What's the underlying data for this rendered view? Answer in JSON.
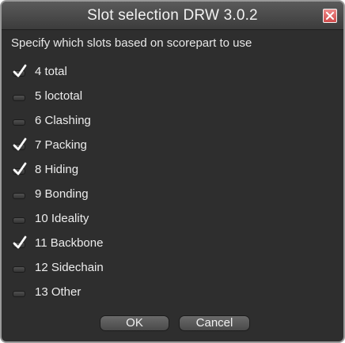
{
  "window": {
    "title": "Slot selection DRW 3.0.2",
    "close_icon": "close-x-icon",
    "close_color": "#d9534f"
  },
  "instructions": "Specify which slots based on scorepart to use",
  "slots": [
    {
      "label": "4 total",
      "checked": true
    },
    {
      "label": "5 loctotal",
      "checked": false
    },
    {
      "label": "6 Clashing",
      "checked": false
    },
    {
      "label": "7 Packing",
      "checked": true
    },
    {
      "label": "8 Hiding",
      "checked": true
    },
    {
      "label": "9 Bonding",
      "checked": false
    },
    {
      "label": "10 Ideality",
      "checked": false
    },
    {
      "label": "11 Backbone",
      "checked": true
    },
    {
      "label": "12 Sidechain",
      "checked": false
    },
    {
      "label": "13 Other",
      "checked": false
    }
  ],
  "buttons": {
    "ok_label": "OK",
    "cancel_label": "Cancel"
  }
}
